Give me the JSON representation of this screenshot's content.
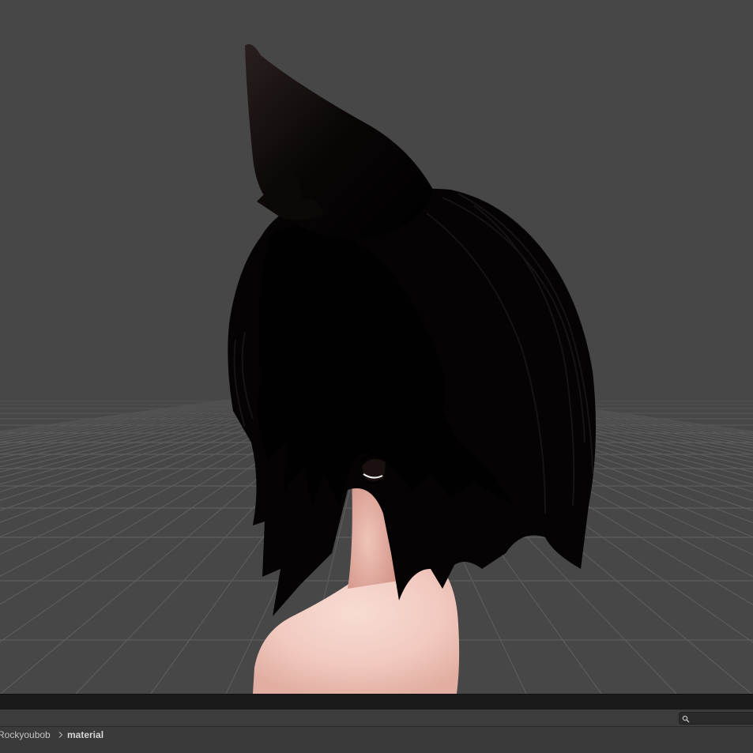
{
  "scene": {
    "background_color": "#474747",
    "grid_color": "#5a5a5a",
    "hair_color": "#0a0707",
    "skin_color": "#f3cfc6"
  },
  "project": {
    "search_value": "",
    "search_icon": "search-icon",
    "breadcrumb": {
      "root": "Rockyoubob",
      "separator_icon": "chevron-right-icon",
      "current": "material"
    }
  }
}
